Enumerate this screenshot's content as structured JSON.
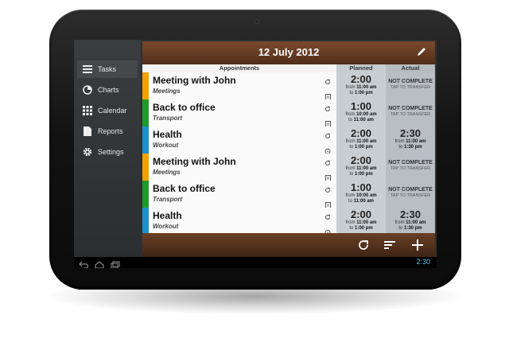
{
  "sidebar": {
    "items": [
      {
        "label": "Tasks",
        "icon": "list-icon",
        "active": true
      },
      {
        "label": "Charts",
        "icon": "pie-chart-icon",
        "active": false
      },
      {
        "label": "Calendar",
        "icon": "calendar-grid-icon",
        "active": false
      },
      {
        "label": "Reports",
        "icon": "document-icon",
        "active": false
      },
      {
        "label": "Settings",
        "icon": "gear-icon",
        "active": false
      }
    ]
  },
  "header": {
    "date": "12 July 2012"
  },
  "columns": {
    "appointments": "Appointments",
    "planned": "Planned",
    "actual": "Actual"
  },
  "rows": [
    {
      "title": "Meeting with John",
      "category": "Meetings",
      "color": "#f2a200",
      "planned": {
        "duration": "2:00",
        "from": "11:00 am",
        "to": "1:00 pm"
      },
      "actual": {
        "status": "NOT COMPLETE",
        "hint": "TAP TO TRANSFER"
      }
    },
    {
      "title": "Back to office",
      "category": "Transport",
      "color": "#1f9a2a",
      "planned": {
        "duration": "1:00",
        "from": "10:00 am",
        "to": "11:00 am"
      },
      "actual": {
        "status": "NOT COMPLETE",
        "hint": "TAP TO TRANSFER"
      }
    },
    {
      "title": "Health",
      "category": "Workout",
      "color": "#1e8fcf",
      "planned": {
        "duration": "2:00",
        "from": "11:00 am",
        "to": "1:00 pm"
      },
      "actual": {
        "duration": "2:30",
        "from": "11:00 am",
        "to": "1:30 pm"
      }
    },
    {
      "title": "Meeting with John",
      "category": "Meetings",
      "color": "#f2a200",
      "planned": {
        "duration": "2:00",
        "from": "11:00 am",
        "to": "1:00 pm"
      },
      "actual": {
        "status": "NOT COMPLETE",
        "hint": "TAP TO TRANSFER"
      }
    },
    {
      "title": "Back to office",
      "category": "Transport",
      "color": "#1f9a2a",
      "planned": {
        "duration": "1:00",
        "from": "10:00 am",
        "to": "11:00 am"
      },
      "actual": {
        "status": "NOT COMPLETE",
        "hint": "TAP TO TRANSFER"
      }
    },
    {
      "title": "Health",
      "category": "Workout",
      "color": "#1e8fcf",
      "planned": {
        "duration": "2:00",
        "from": "11:00 am",
        "to": "1:00 pm"
      },
      "actual": {
        "duration": "2:30",
        "from": "11:00 am",
        "to": "1:30 pm"
      }
    }
  ],
  "labels": {
    "from": "from",
    "to": "to"
  },
  "statusbar": {
    "time": "2:30"
  },
  "colors": {
    "header": "#5e3721",
    "accent": "#4fc3f7"
  }
}
